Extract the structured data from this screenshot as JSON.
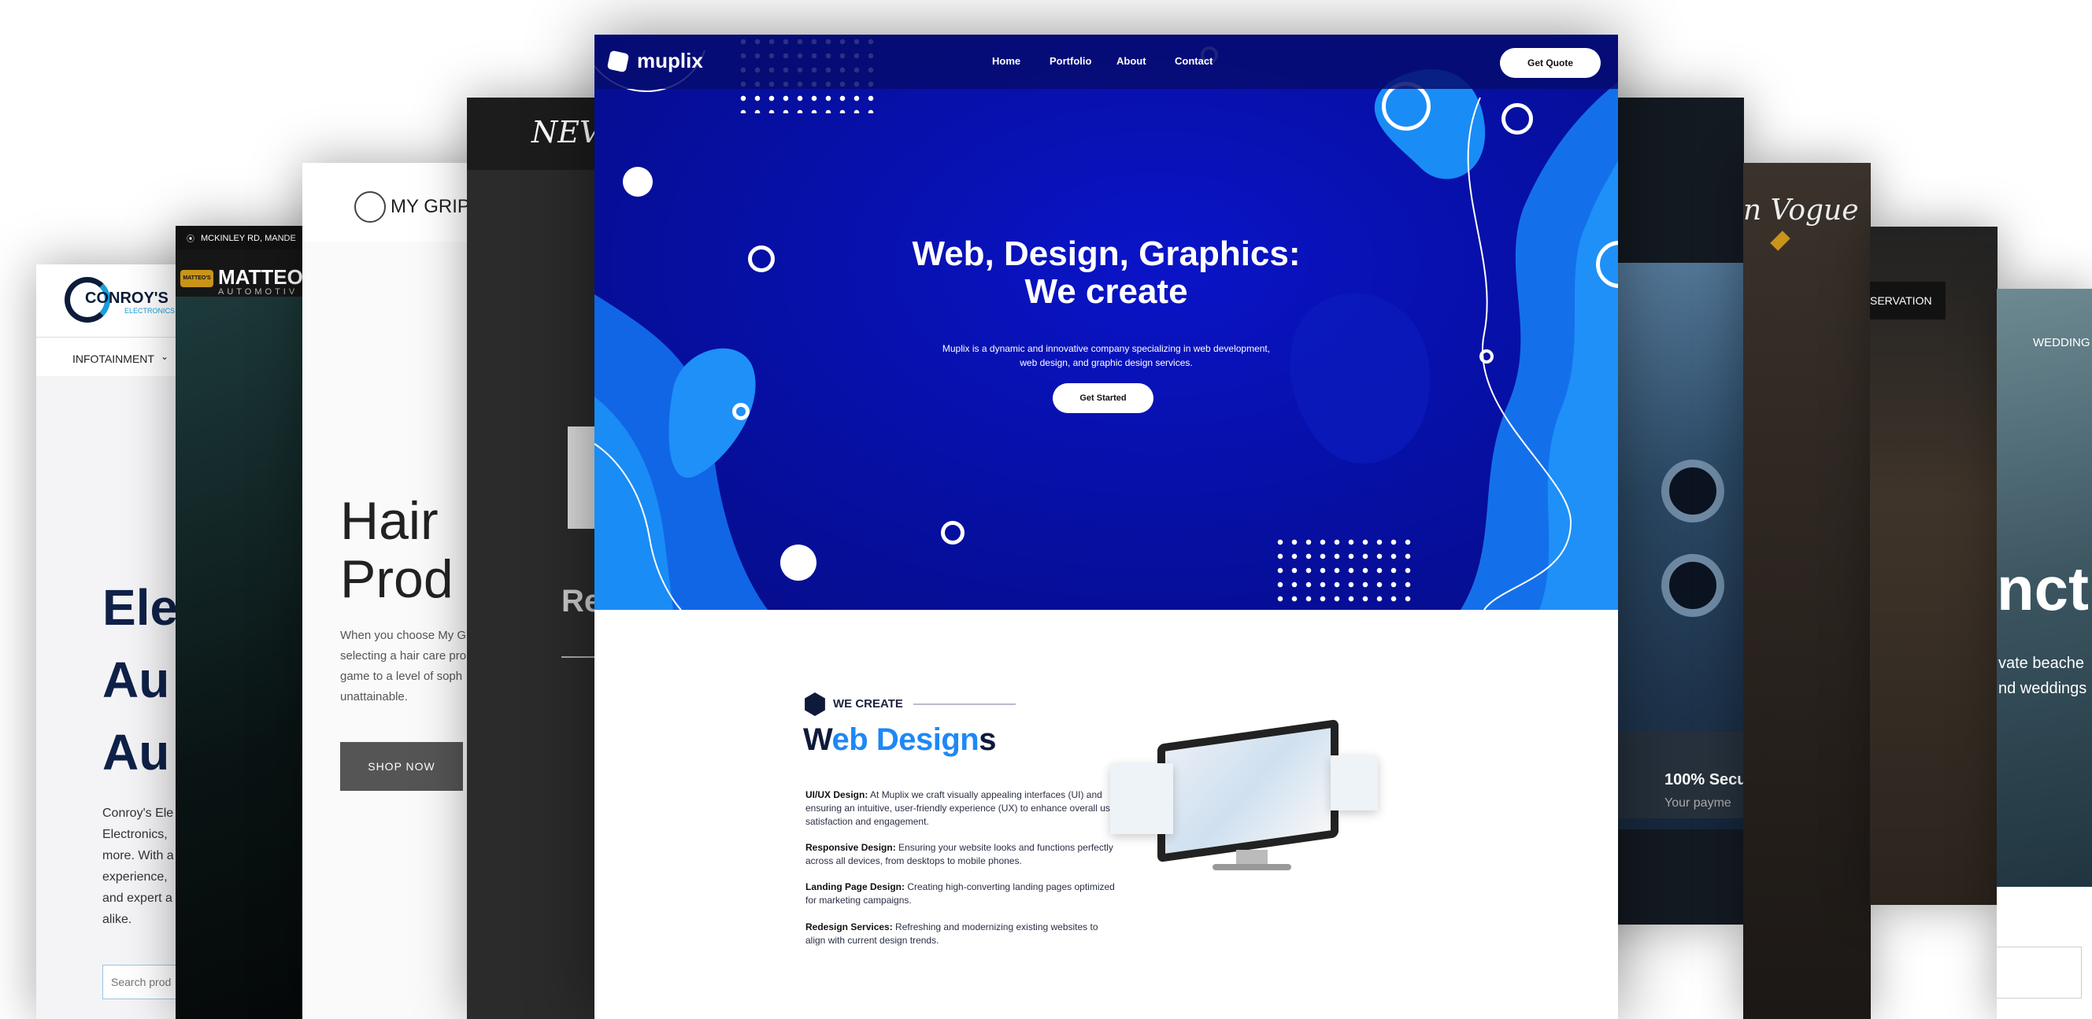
{
  "conroys": {
    "logo_text": "CONROY'S",
    "logo_sub": "ELECTRONICS",
    "nav_item": "INFOTAINMENT",
    "headline_lines": [
      "Ele",
      "Au",
      "Au"
    ],
    "body_lines": [
      "Conroy's Ele",
      "Electronics,",
      "more. With a",
      "experience,",
      "and expert a",
      "alike."
    ],
    "search_placeholder": "Search prod"
  },
  "matteos": {
    "address": "MCKINLEY RD, MANDE",
    "brand": "MATTEO",
    "brand_sub": "AUTOMOTIV",
    "badge": "MATTEO'S"
  },
  "mygrip": {
    "logo": "MY GRIP",
    "headline_lines": [
      "Hair",
      "Prod"
    ],
    "body_lines": [
      "When you choose My Gr",
      "selecting a hair care pro",
      "game to a level of soph",
      "unattainable."
    ],
    "shop_button": "SHOP NOW"
  },
  "nev": {
    "logo": "NEV",
    "headline": "Re"
  },
  "phone": {
    "security_title": "100% Secu",
    "security_sub": "Your payme"
  },
  "vogue": {
    "logo": "n Vogue"
  },
  "reserve": {
    "button": "SERVATION"
  },
  "wedding": {
    "nav": "WEDDING",
    "headline": "nct",
    "body_lines": [
      "vate beache",
      "nd weddings"
    ]
  },
  "muplix": {
    "logo": "muplix",
    "nav": [
      "Home",
      "Portfolio",
      "About",
      "Contact"
    ],
    "quote_button": "Get Quote",
    "hero_title_line1": "Web, Design, Graphics:",
    "hero_title_line2": "We create",
    "hero_subtitle_line1": "Muplix is a dynamic and innovative company specializing in web development,",
    "hero_subtitle_line2": "web design, and graphic design services.",
    "hero_button": "Get Started",
    "section_label": "WE CREATE",
    "section_title_part1": "W",
    "section_title_part2": "eb Design",
    "section_title_part3": "s",
    "features": [
      {
        "title": "UI/UX Design:",
        "text": " At Muplix we craft visually appealing interfaces (UI) and ensuring an intuitive, user-friendly experience (UX) to enhance overall user satisfaction and engagement."
      },
      {
        "title": "Responsive Design:",
        "text": " Ensuring your website looks and functions perfectly across all devices, from desktops to mobile phones."
      },
      {
        "title": "Landing Page Design:",
        "text": " Creating high-converting landing pages optimized for marketing campaigns."
      },
      {
        "title": "Redesign Services:",
        "text": " Refreshing and modernizing existing websites to align with current design trends."
      }
    ]
  },
  "colors": {
    "hero_blue": "#0710a8",
    "accent_blue": "#1e88f5",
    "navy": "#0d1a3a"
  }
}
